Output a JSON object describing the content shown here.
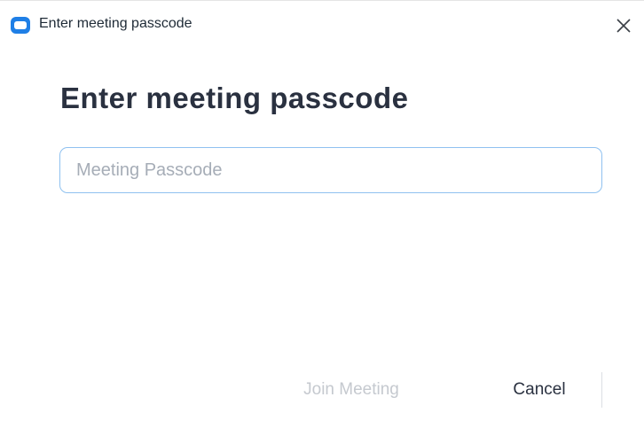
{
  "window": {
    "title": "Enter meeting passcode",
    "app_icon": "zoom-logo-icon",
    "close_icon": "close-icon"
  },
  "main": {
    "heading": "Enter meeting passcode",
    "passcode_input": {
      "value": "",
      "placeholder": "Meeting Passcode"
    }
  },
  "buttons": {
    "join_label": "Join Meeting",
    "join_enabled": false,
    "cancel_label": "Cancel"
  },
  "colors": {
    "accent": "#1f7fe6",
    "input_focus_border": "#8fc1f0",
    "heading_text": "#2a3140"
  }
}
